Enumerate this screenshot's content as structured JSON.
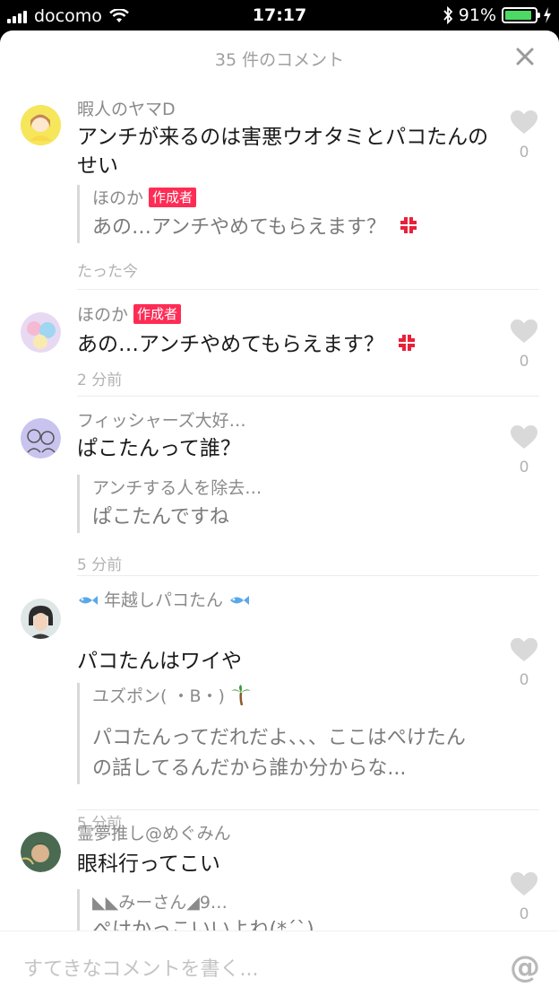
{
  "status_bar": {
    "carrier": "docomo",
    "time": "17:17",
    "battery_percent": "91%",
    "battery_level": 0.91
  },
  "sheet": {
    "title": "35 件のコメント",
    "close_label": "×"
  },
  "comments": [
    {
      "username": "暇人のヤマD",
      "text": "アンチが来るのは害悪ウオタミとパコたんのせい",
      "reply": {
        "name": "ほのか",
        "badge": "作成者",
        "text": "あの…アンチやめてもらえます？"
      },
      "time": "たった今",
      "likes": "0"
    },
    {
      "username": "ほのか",
      "badge": "作成者",
      "text": "あの…アンチやめてもらえます？",
      "time": "2 分前",
      "likes": "0"
    },
    {
      "username": "フィッシャーズ大好…",
      "text": "ぱこたんって誰？",
      "reply": {
        "name": "アンチする人を除去…",
        "text": "ぱこたんですね"
      },
      "time": "5 分前",
      "likes": "0"
    },
    {
      "username": "年越しパコたん",
      "text": "パコたんはワイや",
      "reply": {
        "name": "ユズポン( ・B・)",
        "text": "パコたんってだれだよ、、、ここはぺけたんの話してるんだから誰か分からな..."
      },
      "time": "5 分前",
      "likes": "0"
    },
    {
      "username": "霊夢推し@めぐみん",
      "text": "眼科行ってこい",
      "reply": {
        "name": "◣◣みーさん◢9…",
        "text": "ぺけかっこいいよね(*´`)"
      },
      "likes": "0"
    }
  ],
  "input": {
    "placeholder": "すてきなコメントを書く...",
    "at_label": "@"
  }
}
